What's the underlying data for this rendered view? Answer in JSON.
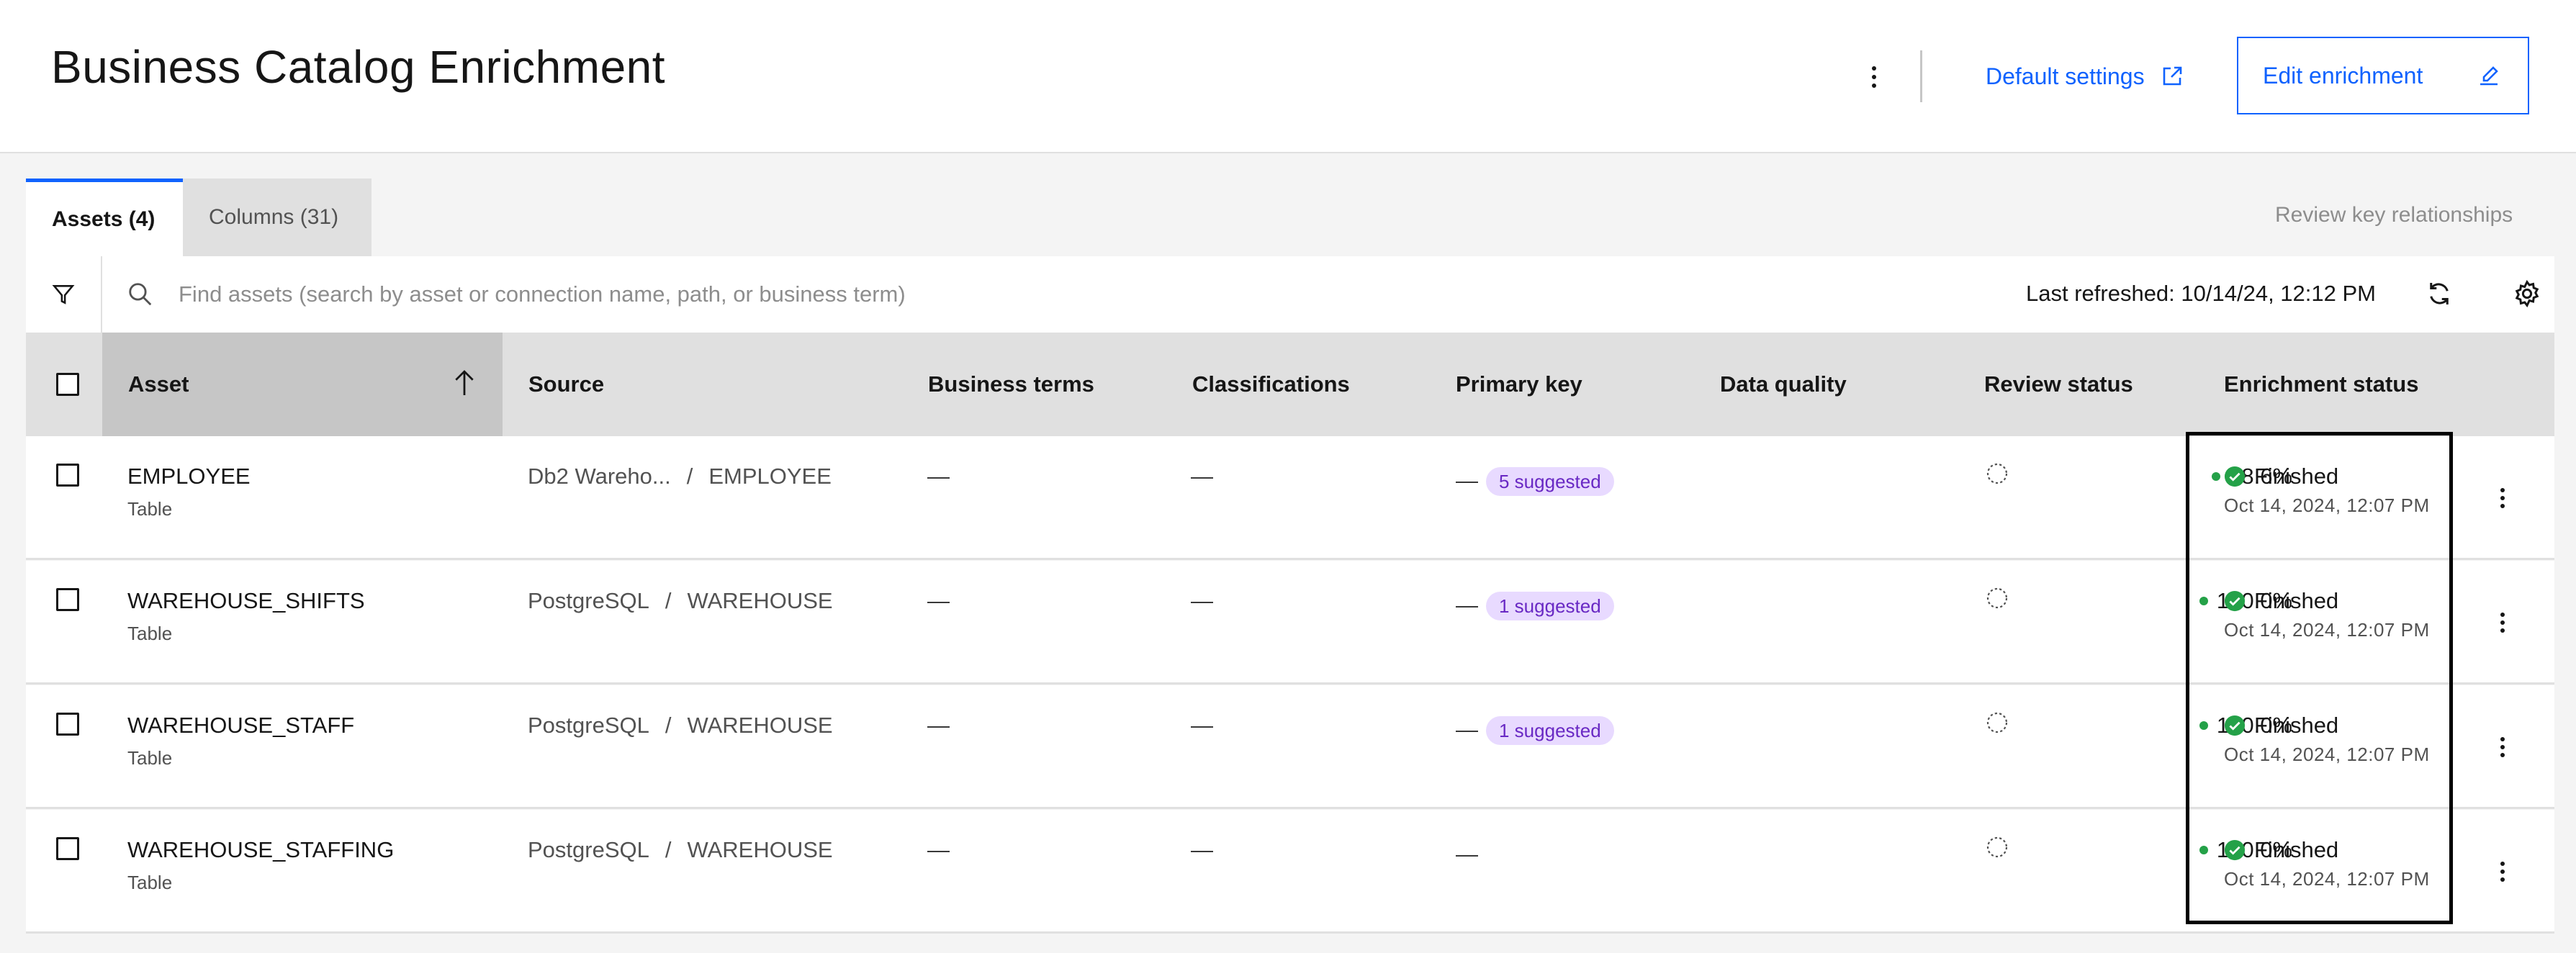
{
  "header": {
    "title": "Business Catalog Enrichment",
    "default_settings_label": "Default settings",
    "edit_label": "Edit enrichment"
  },
  "tabs": [
    {
      "label": "Assets (4)"
    },
    {
      "label": "Columns (31)"
    }
  ],
  "review_key_relationships": "Review key relationships",
  "toolbar": {
    "search_placeholder": "Find assets (search by asset or connection name, path, or business term)",
    "last_refreshed": "Last refreshed: 10/14/24, 12:12 PM"
  },
  "columns": [
    "Asset",
    "Source",
    "Business terms",
    "Classifications",
    "Primary key",
    "Data quality",
    "Review status",
    "Enrichment status"
  ],
  "rows": [
    {
      "name": "EMPLOYEE",
      "type": "Table",
      "source_conn": "Db2 Wareho...",
      "source_sep": "/",
      "source_path": "EMPLOYEE",
      "terms": "—",
      "classifications": "—",
      "pk_dash": "—",
      "pk_tag": "5 suggested",
      "dq": "98.6%",
      "status": "Finished",
      "status_date": "Oct 14, 2024, 12:07 PM"
    },
    {
      "name": "WAREHOUSE_SHIFTS",
      "type": "Table",
      "source_conn": "PostgreSQL",
      "source_sep": "/",
      "source_path": "WAREHOUSE",
      "terms": "—",
      "classifications": "—",
      "pk_dash": "—",
      "pk_tag": "1 suggested",
      "dq": "100.0%",
      "status": "Finished",
      "status_date": "Oct 14, 2024, 12:07 PM"
    },
    {
      "name": "WAREHOUSE_STAFF",
      "type": "Table",
      "source_conn": "PostgreSQL",
      "source_sep": "/",
      "source_path": "WAREHOUSE",
      "terms": "—",
      "classifications": "—",
      "pk_dash": "—",
      "pk_tag": "1 suggested",
      "dq": "100.0%",
      "status": "Finished",
      "status_date": "Oct 14, 2024, 12:07 PM"
    },
    {
      "name": "WAREHOUSE_STAFFING",
      "type": "Table",
      "source_conn": "PostgreSQL",
      "source_sep": "/",
      "source_path": "WAREHOUSE",
      "terms": "—",
      "classifications": "—",
      "pk_dash": "—",
      "pk_tag": "",
      "dq": "100.0%",
      "status": "Finished",
      "status_date": "Oct 14, 2024, 12:07 PM"
    }
  ],
  "colors": {
    "accent": "#0f62fe",
    "success": "#24a148",
    "tag_bg": "#e8daff",
    "tag_text": "#6929c4"
  }
}
